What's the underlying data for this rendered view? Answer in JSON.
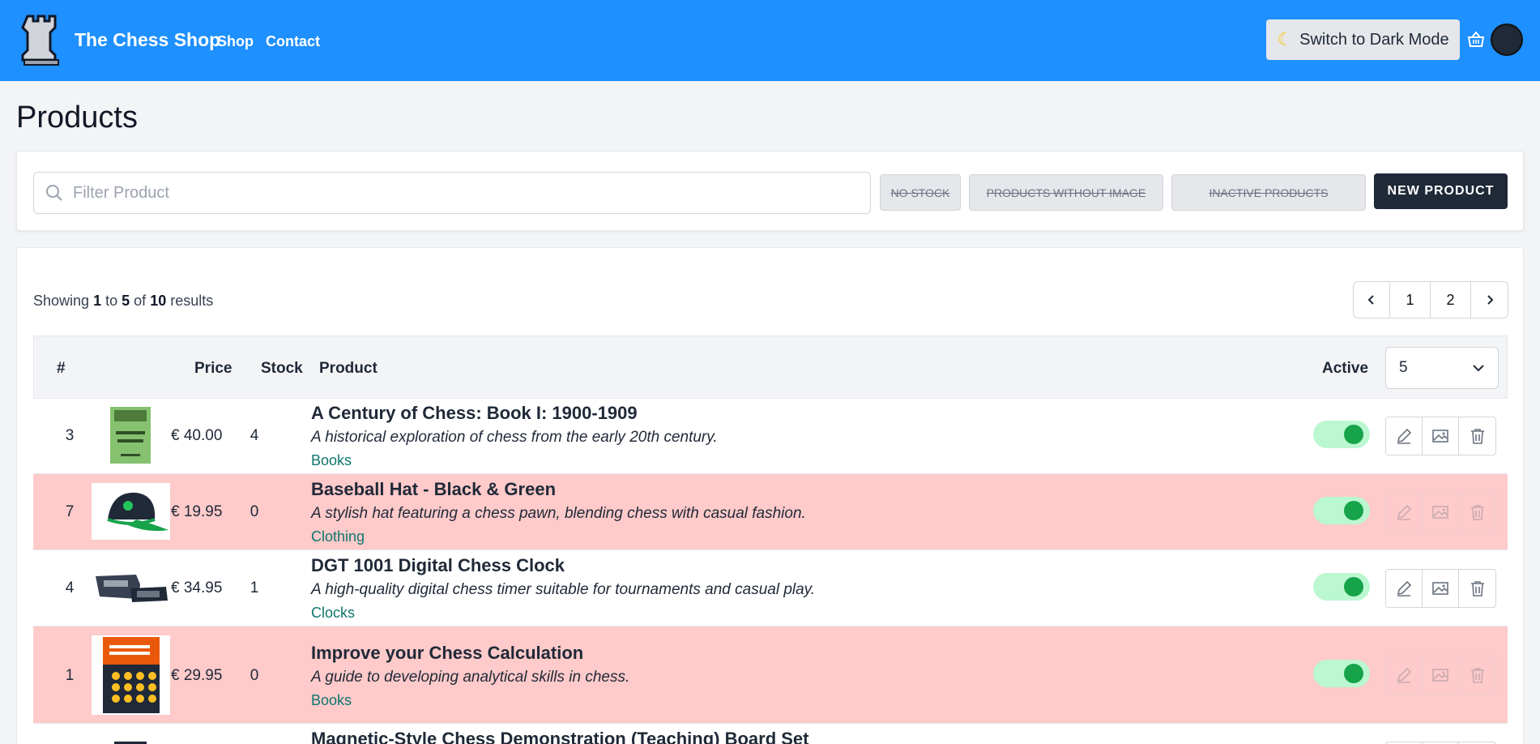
{
  "navbar": {
    "brand": "The Chess Shop",
    "links": [
      "Shop",
      "Contact"
    ],
    "dark_mode_label": "Switch to Dark Mode"
  },
  "page_title": "Products",
  "filters": {
    "search_placeholder": "Filter Product",
    "search_value": "",
    "no_stock": "NO STOCK",
    "without_image": "PRODUCTS WITHOUT IMAGE",
    "inactive": "INACTIVE PRODUCTS",
    "new_product": "NEW PRODUCT"
  },
  "results": {
    "prefix": "Showing",
    "from": "1",
    "to_word": "to",
    "to": "5",
    "of_word": "of",
    "total": "10",
    "suffix": "results"
  },
  "pagination": {
    "pages": [
      "1",
      "2"
    ]
  },
  "table": {
    "headers": {
      "id": "#",
      "price": "Price",
      "stock": "Stock",
      "product": "Product",
      "active": "Active"
    },
    "per_page": "5",
    "rows": [
      {
        "id": "3",
        "price": "€ 40.00",
        "stock": "4",
        "name": "A Century of Chess: Book I: 1900-1909",
        "description": "A historical exploration of chess from the early 20th century.",
        "category": "Books",
        "active": true
      },
      {
        "id": "7",
        "price": "€ 19.95",
        "stock": "0",
        "name": "Baseball Hat - Black & Green",
        "description": "A stylish hat featuring a chess pawn, blending chess with casual fashion.",
        "category": "Clothing",
        "active": true
      },
      {
        "id": "4",
        "price": "€ 34.95",
        "stock": "1",
        "name": "DGT 1001 Digital Chess Clock",
        "description": "A high-quality digital chess timer suitable for tournaments and casual play.",
        "category": "Clocks",
        "active": true
      },
      {
        "id": "1",
        "price": "€ 29.95",
        "stock": "0",
        "name": "Improve your Chess Calculation",
        "description": "A guide to developing analytical skills in chess.",
        "category": "Books",
        "active": true
      },
      {
        "id": "",
        "price": "",
        "stock": "",
        "name": "Magnetic-Style Chess Demonstration (Teaching) Board Set",
        "description": "",
        "category": "",
        "active": true
      }
    ]
  },
  "colors": {
    "navbar": "#1e90ff",
    "no_stock_row": "#fecaca",
    "toggle_on": "#16a34a",
    "category": "#0f766e"
  }
}
